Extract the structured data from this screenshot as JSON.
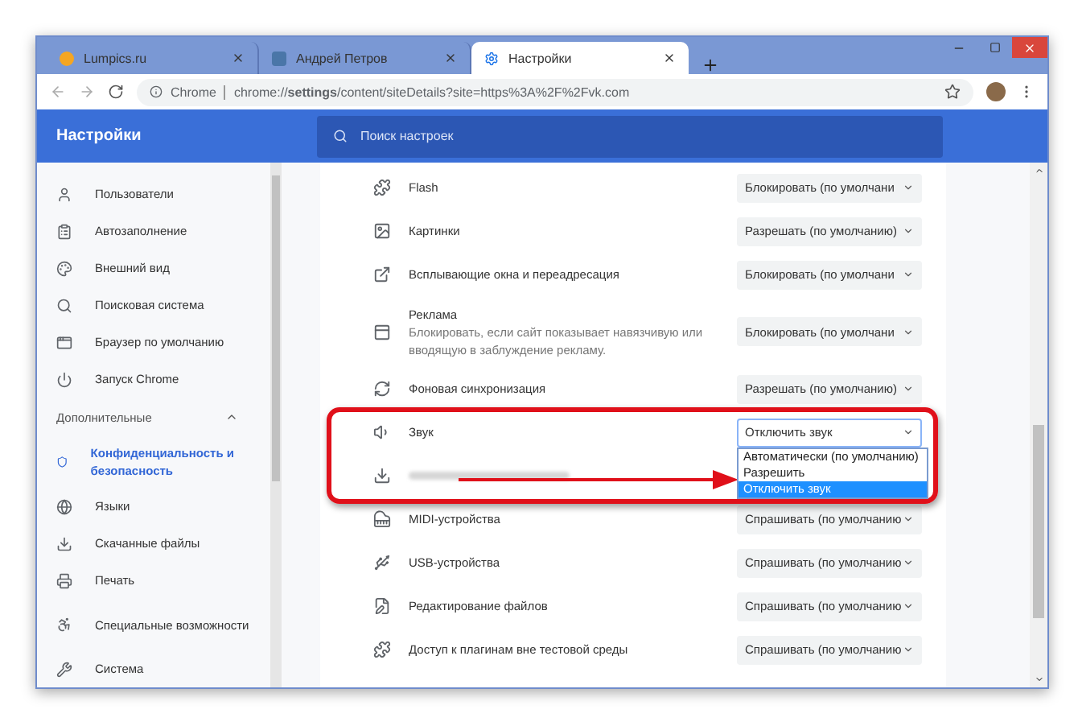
{
  "tabs": [
    {
      "title": "Lumpics.ru",
      "kind": "dot",
      "selected": false
    },
    {
      "title": "Андрей Петров",
      "kind": "vk",
      "selected": false
    },
    {
      "title": "Настройки",
      "kind": "gear",
      "selected": true
    }
  ],
  "address_bar": {
    "chip": "Chrome",
    "url": "chrome://**settings**/content/siteDetails?site=https%3A%2F%2Fvk.com"
  },
  "header": {
    "title": "Настройки",
    "search_placeholder": "Поиск настроек"
  },
  "sidebar": {
    "items": [
      {
        "label": "Пользователи",
        "selected": false
      },
      {
        "label": "Автозаполнение",
        "selected": false
      },
      {
        "label": "Внешний вид",
        "selected": false
      },
      {
        "label": "Поисковая система",
        "selected": false
      },
      {
        "label": "Браузер по умолчанию",
        "selected": false
      },
      {
        "label": "Запуск Chrome",
        "selected": false
      }
    ],
    "section": {
      "label": "Дополнительные",
      "expanded": true
    },
    "advanced_items": [
      {
        "label": "Конфиденциальность и безопасность",
        "selected": true
      },
      {
        "label": "Языки",
        "selected": false
      },
      {
        "label": "Скачанные файлы",
        "selected": false
      },
      {
        "label": "Печать",
        "selected": false
      },
      {
        "label": "Специальные возможности",
        "selected": false
      },
      {
        "label": "Система",
        "selected": false
      }
    ]
  },
  "settings": [
    {
      "label": "Flash",
      "value": "Блокировать (по умолчани"
    },
    {
      "label": "Картинки",
      "value": "Разрешать (по умолчанию)"
    },
    {
      "label": "Всплывающие окна и переадресация",
      "value": "Блокировать (по умолчани"
    },
    {
      "label": "Реклама",
      "description": "Блокировать, если сайт показывает навязчивую или вводящую в заблуждение рекламу.",
      "value": "Блокировать (по умолчани"
    },
    {
      "label": "Фоновая синхронизация",
      "value": "Разрешать (по умолчанию)"
    },
    {
      "label": "Звук",
      "value": "Отключить звук",
      "open": true,
      "options": [
        {
          "label": "Автоматически (по умолчанию)",
          "selected": false
        },
        {
          "label": "Разрешить",
          "selected": false
        },
        {
          "label": "Отключить звук",
          "selected": true
        }
      ]
    },
    {
      "blurred": true
    },
    {
      "label": "MIDI-устройства",
      "value": "Спрашивать (по умолчанию"
    },
    {
      "label": "USB-устройства",
      "value": "Спрашивать (по умолчанию"
    },
    {
      "label": "Редактирование файлов",
      "value": "Спрашивать (по умолчанию"
    },
    {
      "label": "Доступ к плагинам вне тестовой среды",
      "value": "Спрашивать (по умолчанию"
    }
  ]
}
